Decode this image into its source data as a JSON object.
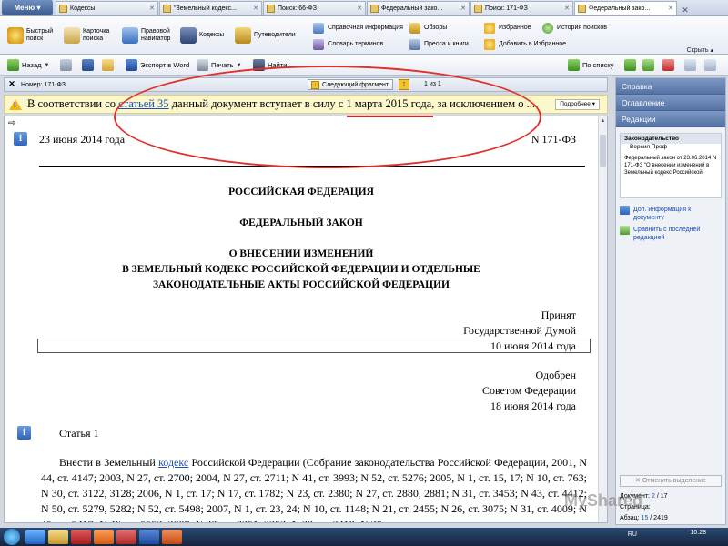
{
  "tabs": {
    "menu_label": "Меню",
    "items": [
      {
        "label": "Кодексы",
        "active": false
      },
      {
        "label": "\"Земельный кодекс...",
        "active": false
      },
      {
        "label": "Поиск: 66-ФЗ",
        "active": false
      },
      {
        "label": "Федеральный зако...",
        "active": false
      },
      {
        "label": "Поиск: 171-ФЗ",
        "active": false
      },
      {
        "label": "Федеральный зако...",
        "active": true
      }
    ]
  },
  "ribbon": {
    "quick_search": "Быстрый поиск",
    "card_search": "Карточка поиска",
    "legal_navigator": "Правовой навигатор",
    "codes": "Кодексы",
    "guides": "Путеводители",
    "reference_info": "Справочная информация",
    "glossary": "Словарь терминов",
    "reviews": "Обзоры",
    "press": "Пресса и книги",
    "favorites": "Избранное",
    "add_favorites": "Добавить в Избранное",
    "search_history": "История поисков",
    "collapse": "Скрыть"
  },
  "toolbar": {
    "back": "Назад",
    "export_word": "Экспорт в Word",
    "print": "Печать",
    "find": "Найти",
    "by_list": "По списку"
  },
  "docbar": {
    "number_label": "Номер: 171-ФЗ",
    "next_fragment": "Следующий фрагмент",
    "counter": "1 из 1"
  },
  "warning": {
    "prefix": "В соответствии со ",
    "link": "статьей 35",
    "suffix": " данный документ вступает в силу с 1 марта 2015 года, за исключением о ...",
    "more_button": "Подробнее"
  },
  "document": {
    "date": "23 июня 2014 года",
    "number": "N 171-ФЗ",
    "heading1": "РОССИЙСКАЯ ФЕДЕРАЦИЯ",
    "heading2": "ФЕДЕРАЛЬНЫЙ ЗАКОН",
    "heading3_l1": "О ВНЕСЕНИИ ИЗМЕНЕНИЙ",
    "heading3_l2": "В ЗЕМЕЛЬНЫЙ КОДЕКС РОССИЙСКОЙ ФЕДЕРАЦИИ И ОТДЕЛЬНЫЕ",
    "heading3_l3": "ЗАКОНОДАТЕЛЬНЫЕ АКТЫ РОССИЙСКОЙ ФЕДЕРАЦИИ",
    "adopted": "Принят",
    "by_duma": "Государственной Думой",
    "adopted_date": "10 июня 2014 года",
    "approved": "Одобрен",
    "by_council": "Советом Федерации",
    "approved_date": "18 июня 2014 года",
    "article": "Статья 1",
    "body_prefix": "Внести в Земельный ",
    "body_link": "кодекс",
    "body_rest": " Российской Федерации (Собрание законодательства Российской Федерации, 2001, N 44, ст. 4147; 2003, N 27, ст. 2700; 2004, N 27, ст. 2711; N 41, ст. 3993; N 52, ст. 5276; 2005, N 1, ст. 15, 17; N 10, ст. 763; N 30, ст. 3122, 3128; 2006, N 1, ст. 17; N 17, ст. 1782; N 23, ст. 2380; N 27, ст. 2880, 2881; N 31, ст. 3453; N 43, ст. 4412; N 50, ст. 5279, 5282; N 52, ст. 5498; 2007, N 1, ст. 23, 24; N 10, ст. 1148; N 21, ст. 2455; N 26, ст. 3075; N 31, ст. 4009; N 45, ст. 5417; N 46, ст. 5553; 2008, N 20, ст. 2251, 2253; N 29, ст. 3418; N 30, ст."
  },
  "sidebar": {
    "help": "Справка",
    "contents": "Оглавление",
    "editions": "Редакции",
    "panel_title": "Законодательство",
    "panel_sub": "Версия Проф",
    "panel_desc": "Федеральный закон от 23.06.2014 N 171-ФЗ \"О внесении изменений в Земельный кодекс Российской",
    "link_info": "Доп. информация к документу",
    "link_compare": "Сравнить с последней редакцией",
    "undo_selection": "Отменить выделение",
    "doc_label": "Документ:",
    "doc_current": "2",
    "doc_total": "/ 17",
    "page_label": "Страница:",
    "para_label": "Абзац:",
    "para_current": "15",
    "para_total": "/ 2419"
  },
  "taskbar": {
    "lang": "RU",
    "time": "10:28"
  },
  "watermark": "MyShared",
  "colors": {
    "accent": "#5573a5",
    "link": "#1a4fb5",
    "warning_bg": "#fdf7cc",
    "annotation": "#e0302a"
  }
}
